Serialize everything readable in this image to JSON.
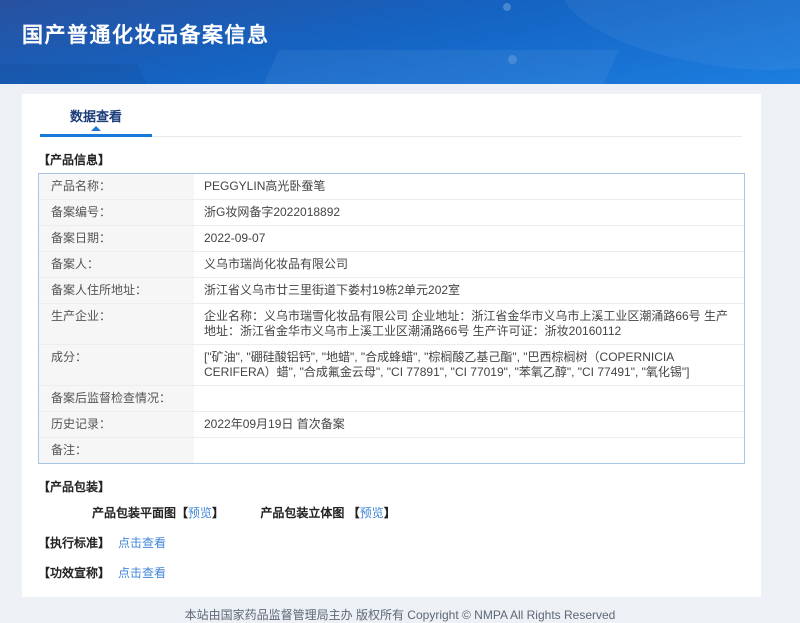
{
  "header": {
    "title": "国产普通化妆品备案信息"
  },
  "tab_bar": {
    "active_tab": "数据查看"
  },
  "sections": {
    "product_info": {
      "title": "【产品信息】",
      "rows": [
        {
          "label": "产品名称：",
          "value": "PEGGYLIN高光卧蚕笔"
        },
        {
          "label": "备案编号：",
          "value": "浙G妆网备字2022018892"
        },
        {
          "label": "备案日期：",
          "value": "2022-09-07"
        },
        {
          "label": "备案人：",
          "value": "义乌市瑞尚化妆品有限公司"
        },
        {
          "label": "备案人住所地址：",
          "value": "浙江省义乌市廿三里街道下娄村19栋2单元202室"
        },
        {
          "label": "生产企业：",
          "value": "企业名称：义乌市瑞雪化妆品有限公司 企业地址：浙江省金华市义乌市上溪工业区潮涌路66号 生产地址：浙江省金华市义乌市上溪工业区潮涌路66号 生产许可证：浙妆20160112"
        },
        {
          "label": "成分：",
          "value": "[\"矿油\", \"硼硅酸铝钙\", \"地蜡\", \"合成蜂蜡\", \"棕榈酸乙基己酯\", \"巴西棕榈树（COPERNICIA CERIFERA）蜡\", \"合成氟金云母\", \"CI 77891\", \"CI 77019\", \"苯氧乙醇\", \"CI 77491\", \"氧化锡\"]"
        },
        {
          "label": "备案后监督检查情况：",
          "value": ""
        },
        {
          "label": "历史记录：",
          "value": "2022年09月19日 首次备案"
        },
        {
          "label": "备注：",
          "value": ""
        }
      ]
    },
    "packaging": {
      "title": "【产品包装】",
      "items": [
        {
          "label": "产品包装平面图",
          "bracket_open": "【",
          "action": "预览",
          "bracket_close": "】"
        },
        {
          "label": "产品包装立体图 ",
          "bracket_open": "【",
          "action": "预览",
          "bracket_close": "】"
        }
      ]
    },
    "standard": {
      "title": "【执行标准】",
      "action": "点击查看"
    },
    "efficacy": {
      "title": "【功效宣称】",
      "action": "点击查看"
    }
  },
  "footer": {
    "text": "本站由国家药品监督管理局主办 版权所有 Copyright © NMPA All Rights Reserved"
  },
  "colors": {
    "accent_blue": "#1778d9",
    "link_blue": "#4086d8",
    "tab_text": "#1c3d7a",
    "header_gradient_start": "#28519f",
    "header_gradient_end": "#1c7ee0",
    "table_border": "#a9c6e6",
    "label_cell_bg": "#f6f6f7",
    "page_bg": "#edf0f4"
  }
}
